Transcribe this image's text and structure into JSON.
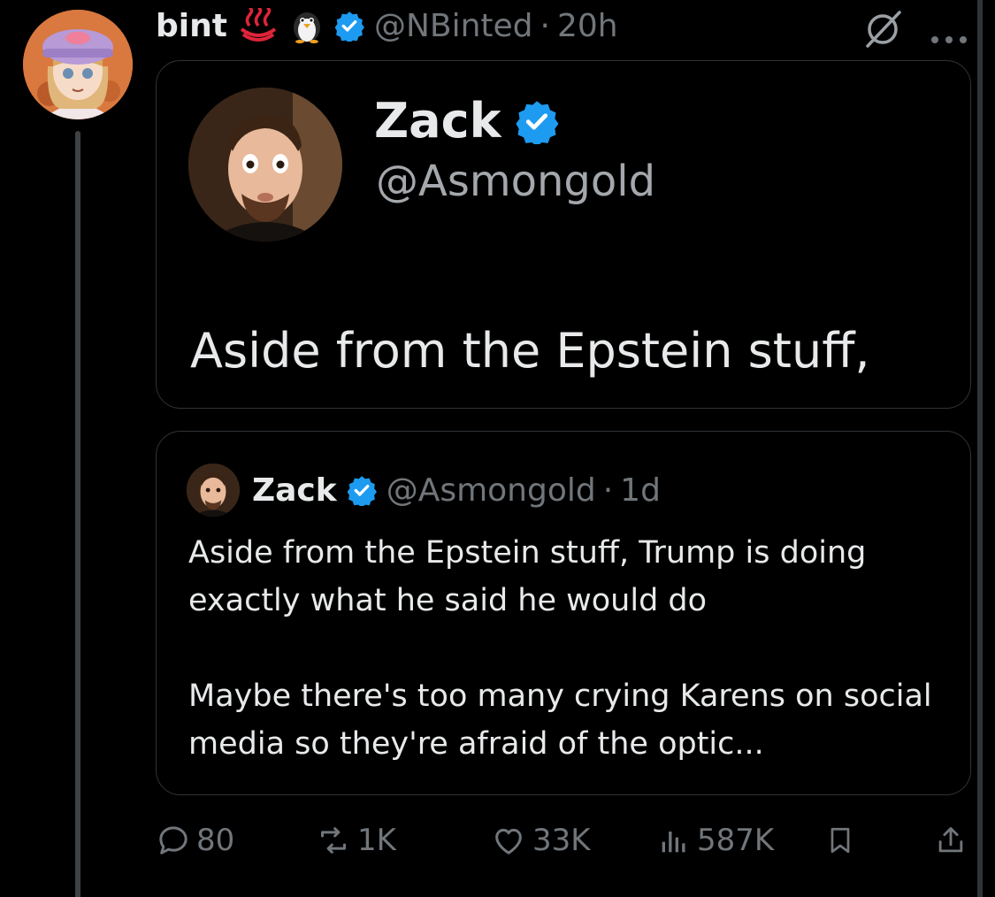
{
  "tweet": {
    "display_name": "bint",
    "emoji": [
      "hot-springs-emoji",
      "penguin-emoji"
    ],
    "handle": "@NBinted",
    "separator": "·",
    "time": "20h"
  },
  "media_card": {
    "name": "Zack",
    "handle": "@Asmongold",
    "text": "Aside from the Epstein stuff,"
  },
  "quote": {
    "name": "Zack",
    "handle": "@Asmongold",
    "separator": "·",
    "time": "1d",
    "paragraphs": [
      "Aside from the Epstein stuff, Trump is doing exactly what he said he would do",
      "Maybe there's too many crying Karens on social media so they're afraid of the optic..."
    ]
  },
  "actions": {
    "replies": "80",
    "reposts": "1K",
    "likes": "33K",
    "views": "587K"
  },
  "colors": {
    "background": "#000000",
    "text": "#e7e9ea",
    "muted": "#71767b",
    "verified": "#1d9bf0",
    "border": "#2f3336"
  },
  "icons": [
    "grok-icon",
    "more-icon",
    "reply-icon",
    "repost-icon",
    "like-icon",
    "views-icon",
    "bookmark-icon",
    "share-icon"
  ]
}
